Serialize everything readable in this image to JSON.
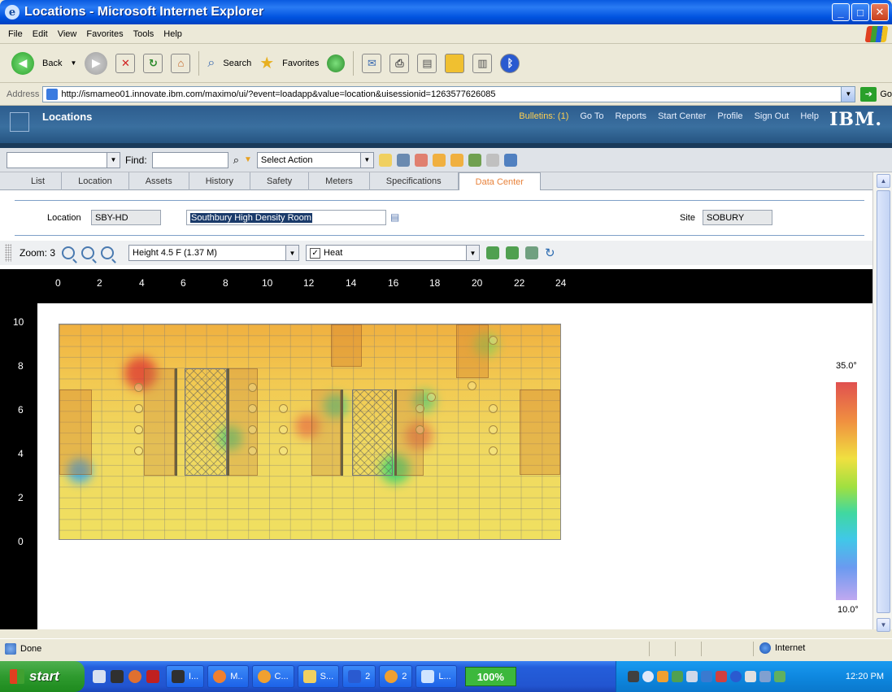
{
  "window": {
    "title": "Locations - Microsoft Internet Explorer"
  },
  "menu": [
    "File",
    "Edit",
    "View",
    "Favorites",
    "Tools",
    "Help"
  ],
  "toolbar": {
    "back": "Back",
    "search": "Search",
    "favorites": "Favorites"
  },
  "address": {
    "label": "Address",
    "url": "http://ismameo01.innovate.ibm.com/maximo/ui/?event=loadapp&value=location&uisessionid=1263577626085",
    "go": "Go"
  },
  "maximo": {
    "app_title": "Locations",
    "links": [
      "Bulletins: (1)",
      "Go To",
      "Reports",
      "Start Center",
      "Profile",
      "Sign Out",
      "Help"
    ],
    "logo": "IBM."
  },
  "mx_toolbar": {
    "find_label": "Find:",
    "action": "Select Action"
  },
  "tabs": [
    "List",
    "Location",
    "Assets",
    "History",
    "Safety",
    "Meters",
    "Specifications",
    "Data Center"
  ],
  "active_tab": "Data Center",
  "form": {
    "location_label": "Location",
    "location_value": "SBY-HD",
    "description": "Southbury High Density Room",
    "site_label": "Site",
    "site_value": "SOBURY"
  },
  "view": {
    "zoom": "Zoom: 3",
    "height": "Height 4.5 F (1.37 M)",
    "layer": "Heat",
    "heat_checked": true
  },
  "ruler": {
    "x": [
      "0",
      "2",
      "4",
      "6",
      "8",
      "10",
      "12",
      "14",
      "16",
      "18",
      "20",
      "22",
      "24"
    ],
    "y": [
      "10",
      "8",
      "6",
      "4",
      "2",
      "0"
    ]
  },
  "legend": {
    "max": "35.0°",
    "min": "10.0°",
    "colors": [
      "#e05050",
      "#f0e040",
      "#40d8a0",
      "#40c8e8",
      "#c0a8f0"
    ]
  },
  "status": {
    "text": "Done",
    "zone": "Internet"
  },
  "taskbar": {
    "start": "start",
    "tasks": [
      "I...",
      "M..",
      "C...",
      "S...",
      "2",
      "2",
      "L..."
    ],
    "zoom": "100%",
    "clock": "12:20 PM"
  }
}
